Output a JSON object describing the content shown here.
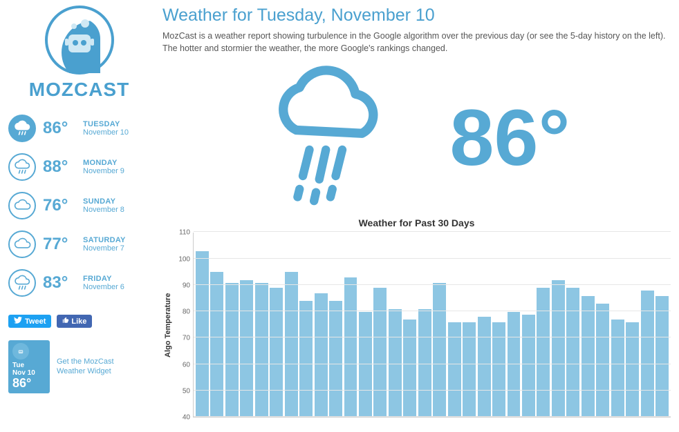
{
  "brand": "MOZCAST",
  "page_title": "Weather for Tuesday, November 10",
  "subtitle": "MozCast is a weather report showing turbulence in the Google algorithm over the previous day (or see the 5-day history on the left). The hotter and stormier the weather, the more Google's rankings changed.",
  "hero_temp": "86°",
  "forecast": [
    {
      "temp": "86°",
      "day": "TUESDAY",
      "date": "November 10",
      "icon": "rain",
      "filled": true
    },
    {
      "temp": "88°",
      "day": "MONDAY",
      "date": "November 9",
      "icon": "rain",
      "filled": false
    },
    {
      "temp": "76°",
      "day": "SUNDAY",
      "date": "November 8",
      "icon": "cloud",
      "filled": false
    },
    {
      "temp": "77°",
      "day": "SATURDAY",
      "date": "November 7",
      "icon": "cloud",
      "filled": false
    },
    {
      "temp": "83°",
      "day": "FRIDAY",
      "date": "November 6",
      "icon": "rain",
      "filled": false
    }
  ],
  "social": {
    "tweet_label": "Tweet",
    "like_label": "Like"
  },
  "widget": {
    "link_text": "Get the MozCast Weather Widget",
    "day": "Tue",
    "date": "Nov 10",
    "temp": "86°"
  },
  "chart_data": {
    "type": "bar",
    "title": "Weather for Past 30 Days",
    "ylabel": "Algo Temperature",
    "xlabel": "",
    "ylim": [
      40,
      110
    ],
    "yticks": [
      40,
      50,
      60,
      70,
      80,
      90,
      100,
      110
    ],
    "values": [
      103,
      95,
      91,
      92,
      91,
      89,
      95,
      84,
      87,
      84,
      93,
      80,
      89,
      81,
      77,
      81,
      91,
      76,
      76,
      78,
      76,
      80,
      79,
      89,
      92,
      89,
      86,
      83,
      77,
      76,
      88,
      86
    ]
  }
}
